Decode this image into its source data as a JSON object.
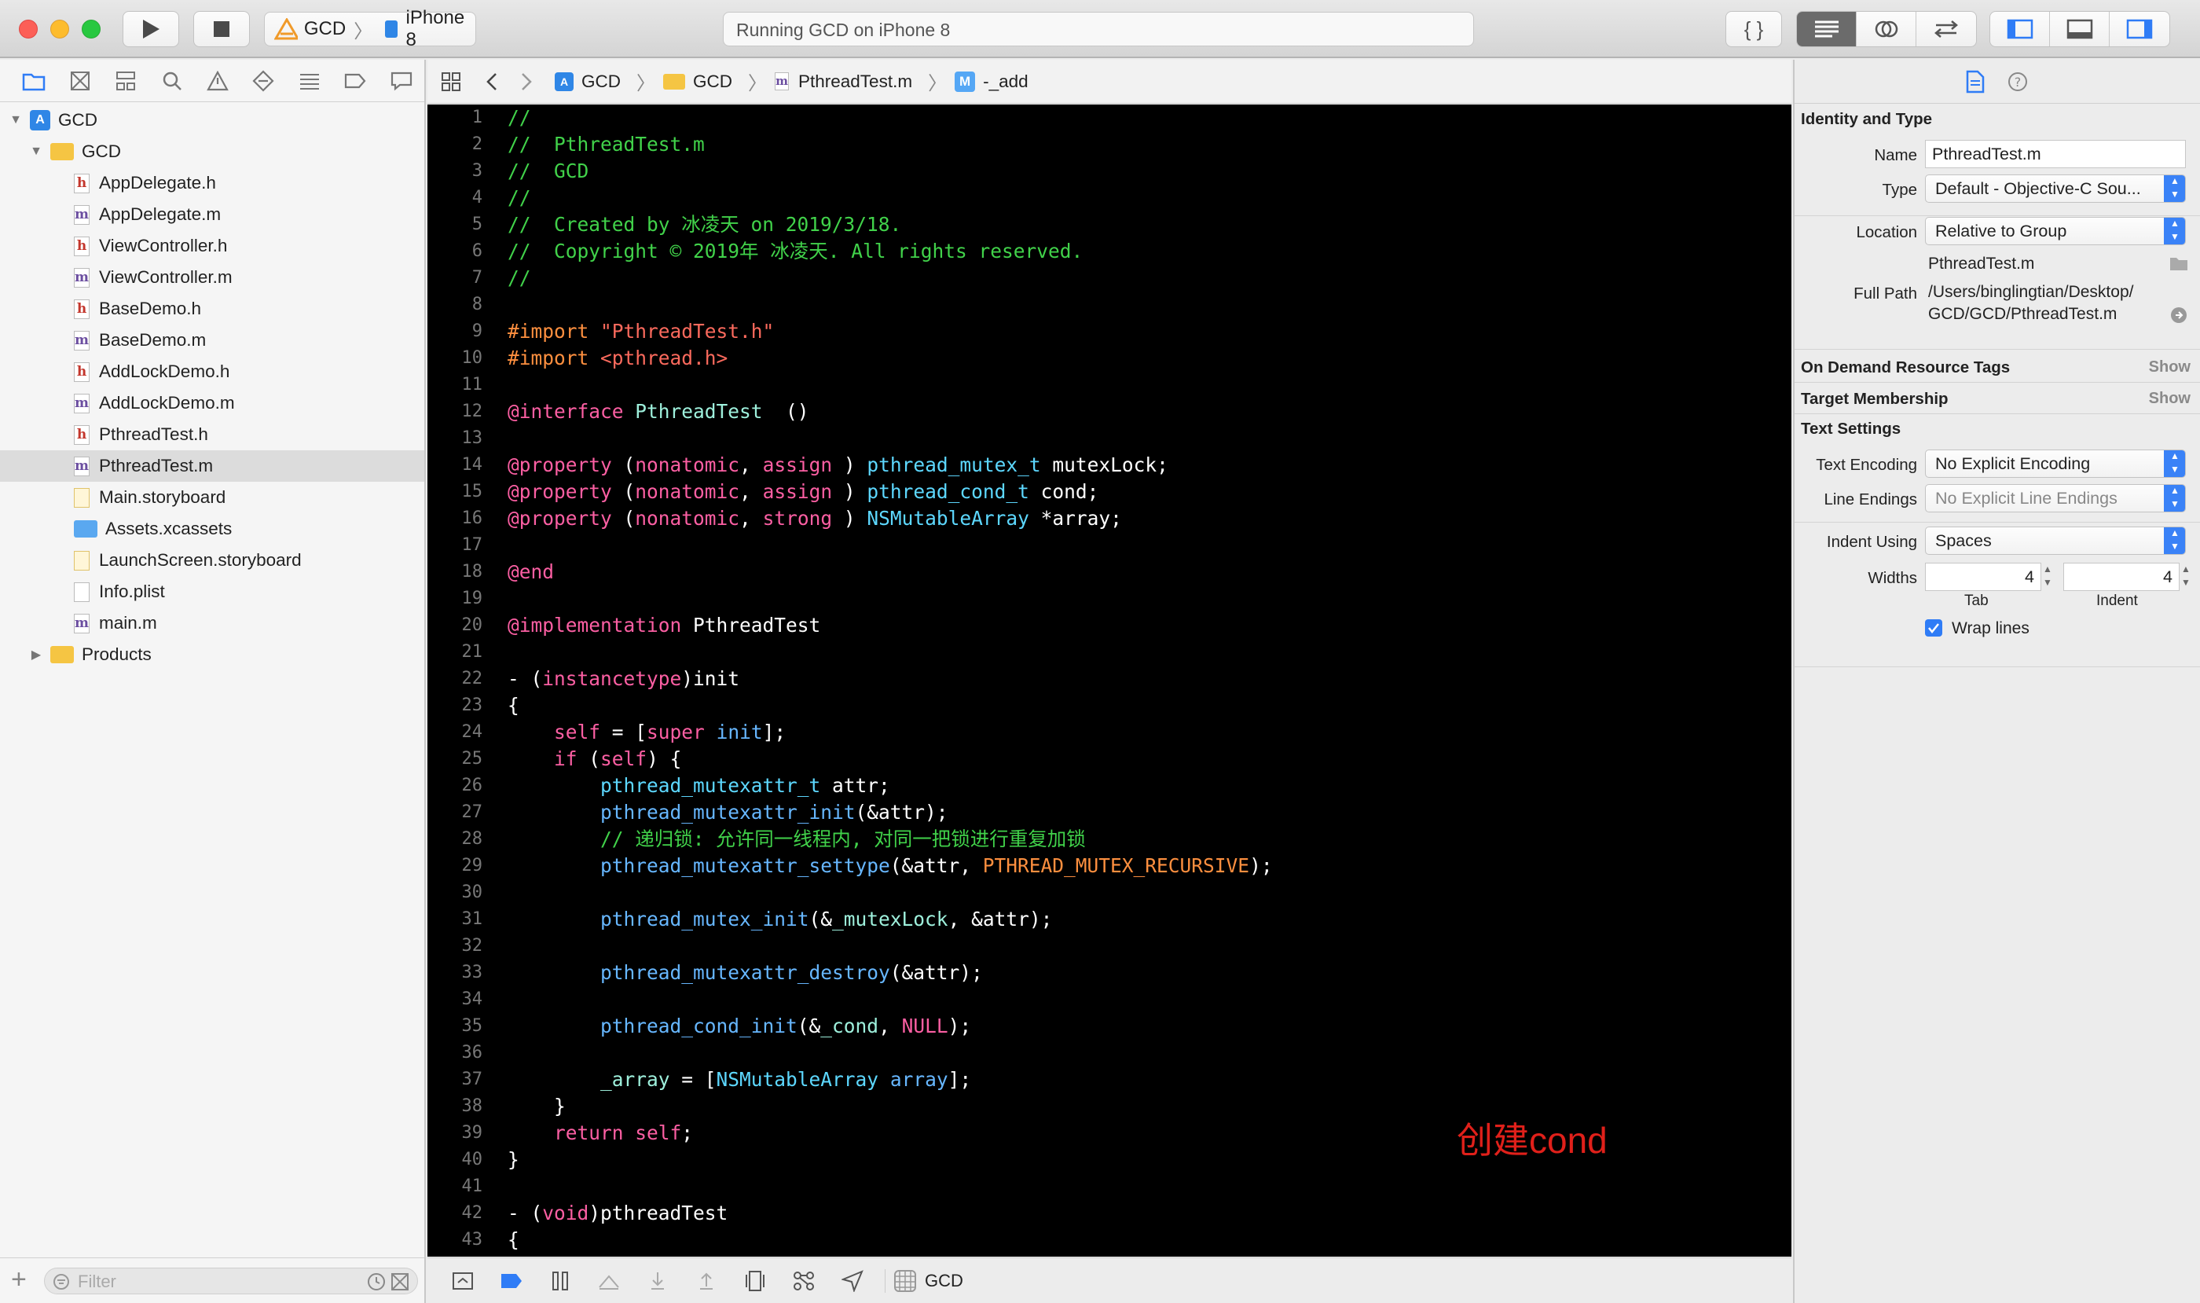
{
  "toolbar": {
    "scheme_project": "GCD",
    "scheme_device": "iPhone 8",
    "status": "Running GCD on iPhone 8"
  },
  "navigator": {
    "project": "GCD",
    "group": "GCD",
    "files": [
      {
        "name": "AppDelegate.h",
        "kind": "h"
      },
      {
        "name": "AppDelegate.m",
        "kind": "m"
      },
      {
        "name": "ViewController.h",
        "kind": "h"
      },
      {
        "name": "ViewController.m",
        "kind": "m"
      },
      {
        "name": "BaseDemo.h",
        "kind": "h"
      },
      {
        "name": "BaseDemo.m",
        "kind": "m"
      },
      {
        "name": "AddLockDemo.h",
        "kind": "h"
      },
      {
        "name": "AddLockDemo.m",
        "kind": "m"
      },
      {
        "name": "PthreadTest.h",
        "kind": "h"
      },
      {
        "name": "PthreadTest.m",
        "kind": "m",
        "selected": true
      },
      {
        "name": "Main.storyboard",
        "kind": "sb"
      },
      {
        "name": "Assets.xcassets",
        "kind": "folder-blue"
      },
      {
        "name": "LaunchScreen.storyboard",
        "kind": "sb"
      },
      {
        "name": "Info.plist",
        "kind": "plist"
      },
      {
        "name": "main.m",
        "kind": "m"
      }
    ],
    "products": "Products",
    "filter_placeholder": "Filter"
  },
  "jumpbar": {
    "crumbs": [
      "GCD",
      "GCD",
      "PthreadTest.m",
      "-_add"
    ],
    "method_badge": "M"
  },
  "editor": {
    "line_numbers": [
      "1",
      "2",
      "3",
      "4",
      "5",
      "6",
      "7",
      "8",
      "9",
      "10",
      "11",
      "12",
      "13",
      "14",
      "15",
      "16",
      "17",
      "18",
      "19",
      "20",
      "21",
      "22",
      "23",
      "24",
      "25",
      "26",
      "27",
      "28",
      "29",
      "30",
      "31",
      "32",
      "33",
      "34",
      "35",
      "36",
      "37",
      "38",
      "39",
      "40",
      "41",
      "42",
      "43"
    ],
    "lines": [
      [
        [
          "cm",
          "//"
        ]
      ],
      [
        [
          "cm",
          "//  PthreadTest.m"
        ]
      ],
      [
        [
          "cm",
          "//  GCD"
        ]
      ],
      [
        [
          "cm",
          "//"
        ]
      ],
      [
        [
          "cm",
          "//  Created by 冰凌天 on 2019/3/18."
        ]
      ],
      [
        [
          "cm",
          "//  Copyright © 2019年 冰凌天. All rights reserved."
        ]
      ],
      [
        [
          "cm",
          "//"
        ]
      ],
      [],
      [
        [
          "pp",
          "#import "
        ],
        [
          "st",
          "\"PthreadTest.h\""
        ]
      ],
      [
        [
          "pp",
          "#import "
        ],
        [
          "st",
          "<pthread.h>"
        ]
      ],
      [],
      [
        [
          "kw",
          "@interface "
        ],
        [
          "cls",
          "PthreadTest"
        ],
        [
          "",
          "  ()"
        ]
      ],
      [],
      [
        [
          "kw",
          "@property "
        ],
        [
          "",
          "("
        ],
        [
          "kw",
          "nonatomic"
        ],
        [
          "",
          ", "
        ],
        [
          "kw",
          "assign"
        ],
        [
          "",
          " ) "
        ],
        [
          "ty",
          "pthread_mutex_t"
        ],
        [
          "",
          " mutexLock;"
        ]
      ],
      [
        [
          "kw",
          "@property "
        ],
        [
          "",
          "("
        ],
        [
          "kw",
          "nonatomic"
        ],
        [
          "",
          ", "
        ],
        [
          "kw",
          "assign"
        ],
        [
          "",
          " ) "
        ],
        [
          "ty",
          "pthread_cond_t"
        ],
        [
          "",
          " cond;"
        ]
      ],
      [
        [
          "kw",
          "@property "
        ],
        [
          "",
          "("
        ],
        [
          "kw",
          "nonatomic"
        ],
        [
          "",
          ", "
        ],
        [
          "kw",
          "strong"
        ],
        [
          "",
          " ) "
        ],
        [
          "ty",
          "NSMutableArray"
        ],
        [
          "",
          " *array;"
        ]
      ],
      [],
      [
        [
          "kw",
          "@end"
        ]
      ],
      [],
      [
        [
          "kw",
          "@implementation "
        ],
        [
          "",
          "PthreadTest"
        ]
      ],
      [],
      [
        [
          "",
          "- ("
        ],
        [
          "kw",
          "instancetype"
        ],
        [
          "",
          ")init"
        ]
      ],
      [
        [
          "",
          "{"
        ]
      ],
      [
        [
          "",
          "    "
        ],
        [
          "kw",
          "self"
        ],
        [
          "",
          " = ["
        ],
        [
          "kw",
          "super"
        ],
        [
          "",
          " "
        ],
        [
          "fn",
          "init"
        ],
        [
          "",
          "];"
        ]
      ],
      [
        [
          "",
          "    "
        ],
        [
          "kw",
          "if"
        ],
        [
          "",
          " ("
        ],
        [
          "kw",
          "self"
        ],
        [
          "",
          ") {"
        ]
      ],
      [
        [
          "",
          "        "
        ],
        [
          "ty",
          "pthread_mutexattr_t"
        ],
        [
          "",
          " attr;"
        ]
      ],
      [
        [
          "",
          "        "
        ],
        [
          "fn",
          "pthread_mutexattr_init"
        ],
        [
          "",
          "(&attr);"
        ]
      ],
      [
        [
          "",
          "        "
        ],
        [
          "cm",
          "// 递归锁: 允许同一线程内, 对同一把锁进行重复加锁"
        ]
      ],
      [
        [
          "",
          "        "
        ],
        [
          "fn",
          "pthread_mutexattr_settype"
        ],
        [
          "",
          "(&attr, "
        ],
        [
          "mc",
          "PTHREAD_MUTEX_RECURSIVE"
        ],
        [
          "",
          ");"
        ]
      ],
      [],
      [
        [
          "",
          "        "
        ],
        [
          "fn",
          "pthread_mutex_init"
        ],
        [
          "",
          "(&"
        ],
        [
          "cls",
          "_mutexLock"
        ],
        [
          "",
          ", &attr);"
        ]
      ],
      [],
      [
        [
          "",
          "        "
        ],
        [
          "fn",
          "pthread_mutexattr_destroy"
        ],
        [
          "",
          "(&attr);"
        ]
      ],
      [],
      [
        [
          "",
          "        "
        ],
        [
          "fn",
          "pthread_cond_init"
        ],
        [
          "",
          "(&"
        ],
        [
          "cls",
          "_cond"
        ],
        [
          "",
          ", "
        ],
        [
          "kw",
          "NULL"
        ],
        [
          "",
          ");"
        ]
      ],
      [],
      [
        [
          "",
          "        "
        ],
        [
          "cls",
          "_array"
        ],
        [
          "",
          " = ["
        ],
        [
          "ty",
          "NSMutableArray"
        ],
        [
          "",
          " "
        ],
        [
          "fn",
          "array"
        ],
        [
          "",
          "];"
        ]
      ],
      [
        [
          "",
          "    }"
        ]
      ],
      [
        [
          "",
          "    "
        ],
        [
          "kw",
          "return self"
        ],
        [
          "",
          ";"
        ]
      ],
      [
        [
          "",
          "}"
        ]
      ],
      [],
      [
        [
          "",
          "- ("
        ],
        [
          "kw",
          "void"
        ],
        [
          "",
          ")pthreadTest"
        ]
      ],
      [
        [
          "",
          "{"
        ]
      ]
    ],
    "annotation": "创建cond"
  },
  "debugbar": {
    "target": "GCD"
  },
  "inspector": {
    "identity_title": "Identity and Type",
    "name_label": "Name",
    "name_value": "PthreadTest.m",
    "type_label": "Type",
    "type_value": "Default - Objective-C Sou...",
    "location_label": "Location",
    "location_value": "Relative to Group",
    "location_file": "PthreadTest.m",
    "fullpath_label": "Full Path",
    "fullpath_line1": "/Users/binglingtian/Desktop/",
    "fullpath_line2": "GCD/GCD/PthreadTest.m",
    "odr_title": "On Demand Resource Tags",
    "odr_show": "Show",
    "target_title": "Target Membership",
    "target_show": "Show",
    "text_settings_title": "Text Settings",
    "encoding_label": "Text Encoding",
    "encoding_value": "No Explicit Encoding",
    "endings_label": "Line Endings",
    "endings_value": "No Explicit Line Endings",
    "indent_label": "Indent Using",
    "indent_value": "Spaces",
    "widths_label": "Widths",
    "tab_value": "4",
    "indent_width_value": "4",
    "tab_caption": "Tab",
    "indent_caption": "Indent",
    "wrap_label": "Wrap lines",
    "wrap_checked": true
  }
}
